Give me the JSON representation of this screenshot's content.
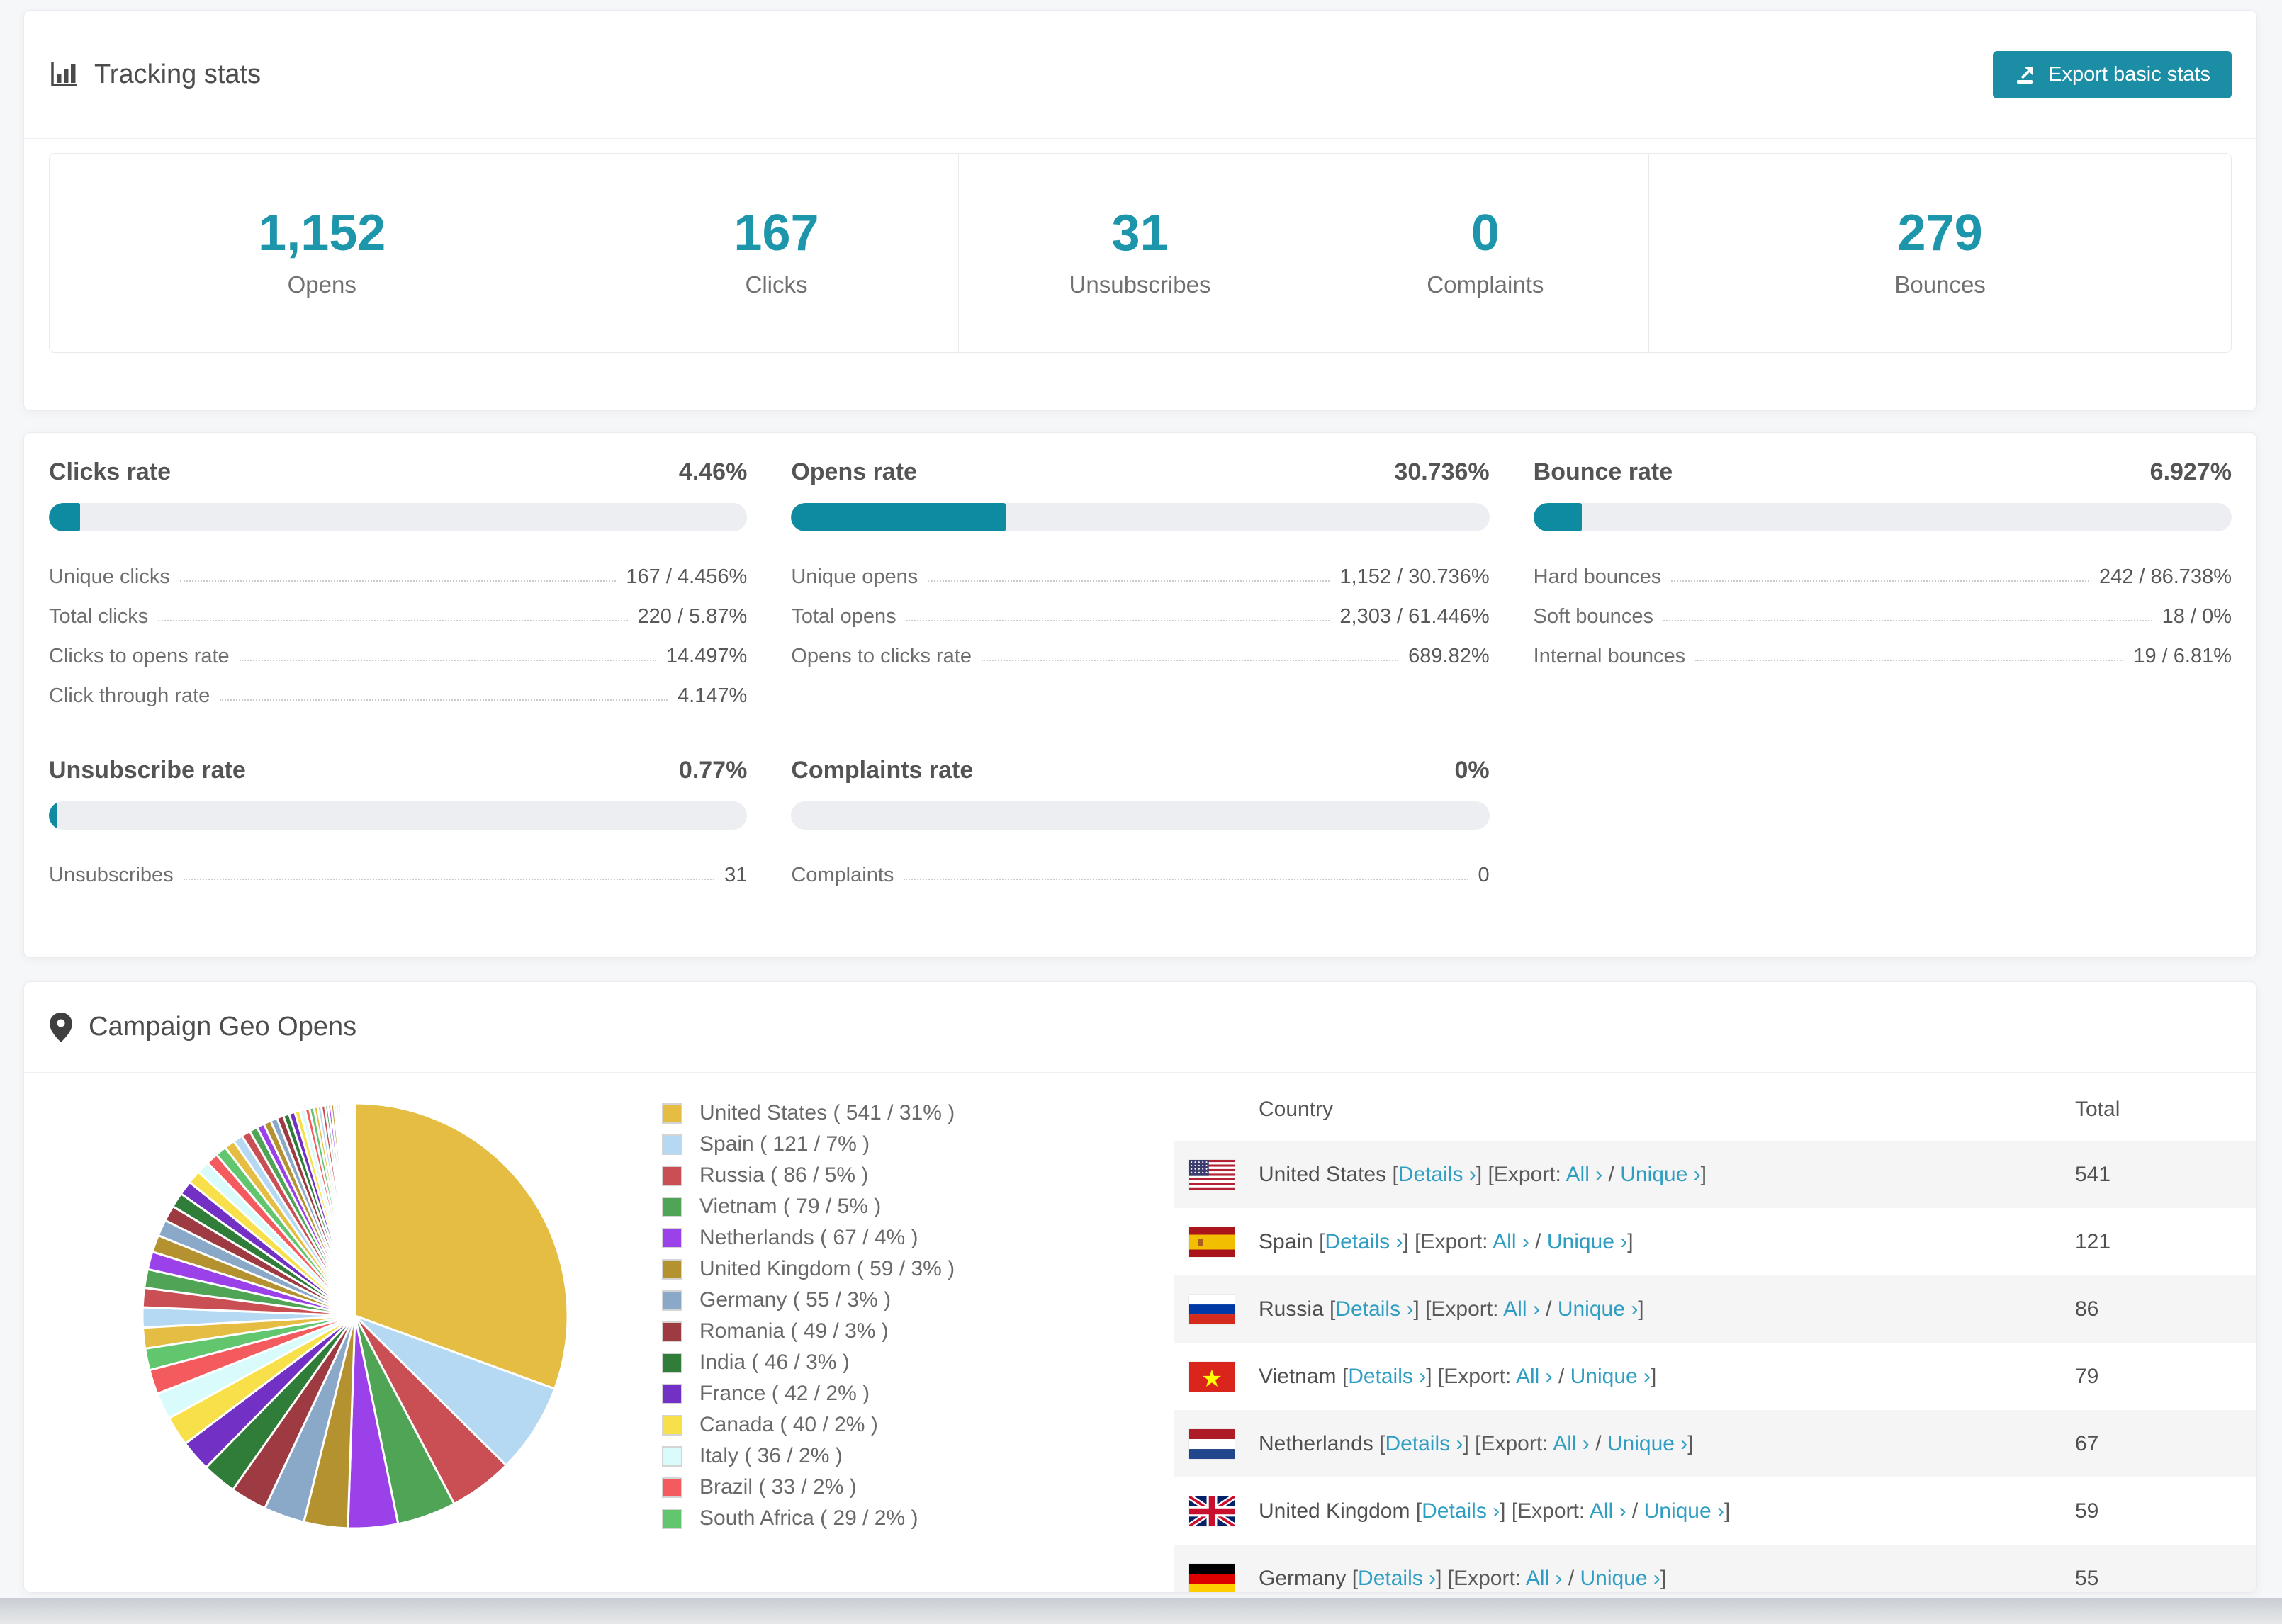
{
  "colors": {
    "accent": "#1d96ac",
    "button_bg": "#1b8da4",
    "bar_fill": "#0f8ba1",
    "bar_track": "#edeef2",
    "link": "#2f9ec2",
    "table_stripe": "#f5f5f6",
    "palette": [
      "#e5bd42",
      "#b5d9f2",
      "#c94f55",
      "#4fa455",
      "#9b41ea",
      "#b3922f",
      "#8aa9c9",
      "#9e3a41",
      "#2f7d39",
      "#7230c4",
      "#f7e04a",
      "#d9fbfb",
      "#f45b5e",
      "#62c66e"
    ]
  },
  "tracking": {
    "title": "Tracking stats",
    "export_button": "Export basic stats",
    "stats": [
      {
        "value": "1,152",
        "label": "Opens"
      },
      {
        "value": "167",
        "label": "Clicks"
      },
      {
        "value": "31",
        "label": "Unsubscribes"
      },
      {
        "value": "0",
        "label": "Complaints"
      },
      {
        "value": "279",
        "label": "Bounces"
      }
    ]
  },
  "rates": [
    {
      "title": "Clicks rate",
      "value": "4.46%",
      "percent": 4.46,
      "rows": [
        [
          "Unique clicks",
          "167 / 4.456%"
        ],
        [
          "Total clicks",
          "220 / 5.87%"
        ],
        [
          "Clicks to opens rate",
          "14.497%"
        ],
        [
          "Click through rate",
          "4.147%"
        ]
      ]
    },
    {
      "title": "Opens rate",
      "value": "30.736%",
      "percent": 30.736,
      "rows": [
        [
          "Unique opens",
          "1,152 / 30.736%"
        ],
        [
          "Total opens",
          "2,303 / 61.446%"
        ],
        [
          "Opens to clicks rate",
          "689.82%"
        ]
      ]
    },
    {
      "title": "Bounce rate",
      "value": "6.927%",
      "percent": 6.927,
      "rows": [
        [
          "Hard bounces",
          "242 / 86.738%"
        ],
        [
          "Soft bounces",
          "18 / 0%"
        ],
        [
          "Internal bounces",
          "19 / 6.81%"
        ]
      ]
    },
    {
      "title": "Unsubscribe rate",
      "value": "0.77%",
      "percent": 0.77,
      "rows": [
        [
          "Unsubscribes",
          "31"
        ]
      ]
    },
    {
      "title": "Complaints rate",
      "value": "0%",
      "percent": 0,
      "rows": [
        [
          "Complaints",
          "0"
        ]
      ]
    }
  ],
  "geo": {
    "title": "Campaign Geo Opens",
    "link_details": "Details",
    "link_export_prefix": "Export:",
    "link_all": "All",
    "link_unique": "Unique",
    "chevron": "›",
    "table": {
      "header_country": "Country",
      "header_total": "Total",
      "rows": [
        {
          "country": "United States",
          "flag": "us",
          "total": "541"
        },
        {
          "country": "Spain",
          "flag": "es",
          "total": "121"
        },
        {
          "country": "Russia",
          "flag": "ru",
          "total": "86"
        },
        {
          "country": "Vietnam",
          "flag": "vn",
          "total": "79"
        },
        {
          "country": "Netherlands",
          "flag": "nl",
          "total": "67"
        },
        {
          "country": "United Kingdom",
          "flag": "gb",
          "total": "59"
        },
        {
          "country": "Germany",
          "flag": "de",
          "total": "55"
        }
      ]
    }
  },
  "chart_data": {
    "type": "pie",
    "title": "Campaign Geo Opens",
    "legend_position": "right",
    "series": [
      {
        "name": "United States",
        "value": 541,
        "pct": "31%"
      },
      {
        "name": "Spain",
        "value": 121,
        "pct": "7%"
      },
      {
        "name": "Russia",
        "value": 86,
        "pct": "5%"
      },
      {
        "name": "Vietnam",
        "value": 79,
        "pct": "5%"
      },
      {
        "name": "Netherlands",
        "value": 67,
        "pct": "4%"
      },
      {
        "name": "United Kingdom",
        "value": 59,
        "pct": "3%"
      },
      {
        "name": "Germany",
        "value": 55,
        "pct": "3%"
      },
      {
        "name": "Romania",
        "value": 49,
        "pct": "3%"
      },
      {
        "name": "India",
        "value": 46,
        "pct": "3%"
      },
      {
        "name": "France",
        "value": 42,
        "pct": "2%"
      },
      {
        "name": "Canada",
        "value": 40,
        "pct": "2%"
      },
      {
        "name": "Italy",
        "value": 36,
        "pct": "2%"
      },
      {
        "name": "Brazil",
        "value": 33,
        "pct": "2%"
      },
      {
        "name": "South Africa",
        "value": 29,
        "pct": "2%"
      }
    ],
    "unlabeled_small_slices": [
      28,
      27,
      26,
      25,
      24,
      23,
      22,
      21,
      20,
      19,
      18,
      17,
      16,
      15,
      14,
      13,
      12,
      11,
      10,
      10,
      9,
      9,
      8,
      8,
      7,
      7,
      6,
      6,
      5,
      5,
      5,
      4,
      4,
      4,
      3,
      3,
      3,
      3,
      2,
      2,
      2,
      2,
      2,
      2,
      1,
      1,
      1,
      1
    ]
  }
}
